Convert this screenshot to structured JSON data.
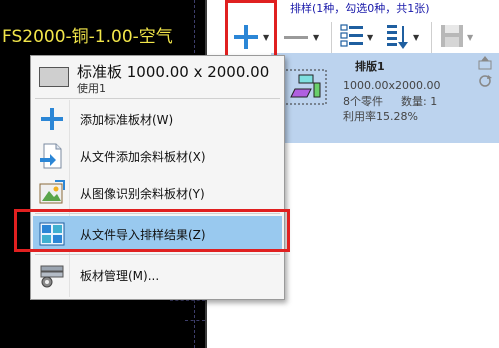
{
  "canvas": {
    "title": "FS2000-铜-1.00-空气",
    "background": "#000000",
    "title_color": "#f2e64a"
  },
  "toolbar": {
    "status_text": "排样(1种，勾选0种，共1张)",
    "buttons": [
      {
        "name": "add-sheet-button",
        "icon": "plus-icon",
        "has_dropdown": true
      },
      {
        "name": "remove-sheet-button",
        "icon": "minus-icon",
        "has_dropdown": true
      },
      {
        "name": "list-view-button",
        "icon": "list-icon",
        "has_dropdown": true
      },
      {
        "name": "sort-button",
        "icon": "sort-icon",
        "has_dropdown": true
      },
      {
        "name": "save-button",
        "icon": "floppy-icon",
        "has_dropdown": true
      }
    ]
  },
  "layout_item": {
    "name": "排版1",
    "size": "1000.00x2000.00",
    "parts": "8个零件",
    "quantity": "数量: 1",
    "utilization": "利用率15.28%"
  },
  "menu": {
    "header": {
      "title": "标准板 1000.00 x 2000.00",
      "subtitle": "使用1"
    },
    "items": [
      {
        "label": "添加标准板材(W)",
        "icon": "plus-icon"
      },
      {
        "label": "从文件添加余料板材(X)",
        "icon": "file-import-icon"
      },
      {
        "label": "从图像识别余料板材(Y)",
        "icon": "image-recognize-icon"
      },
      {
        "label": "从文件导入排样结果(Z)",
        "icon": "layout-import-icon"
      },
      {
        "label": "板材管理(M)...",
        "icon": "sheet-manage-icon"
      }
    ]
  },
  "colors": {
    "highlight_border": "#e02020",
    "menu_selected": "#99c9ef",
    "list_selected": "#bcd3ee",
    "accent_blue": "#1e7fd8"
  }
}
